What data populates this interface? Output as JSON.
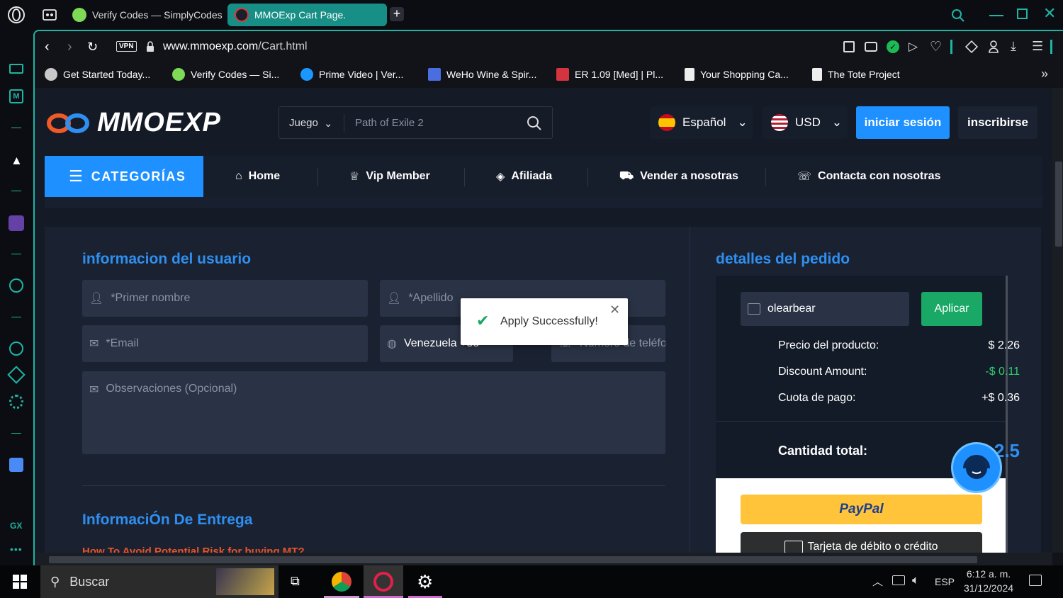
{
  "browser": {
    "tabs": [
      {
        "label": "Verify Codes — SimplyCodes"
      },
      {
        "label": "MMOExp Cart Page."
      }
    ],
    "vpn_label": "VPN",
    "url_host": "www.mmoexp.com",
    "url_path": "/Cart.html",
    "bookmarks": [
      {
        "label": "Get Started Today..."
      },
      {
        "label": "Verify Codes — Si..."
      },
      {
        "label": "Prime Video | Ver..."
      },
      {
        "label": "WeHo Wine & Spir..."
      },
      {
        "label": "ER 1.09 [Med] | Pl..."
      },
      {
        "label": "Your Shopping Ca..."
      },
      {
        "label": "The Tote Project"
      }
    ],
    "sidebar_gx": "GX",
    "accent": "#1db5a5"
  },
  "site": {
    "logo": "MMOEXP",
    "game_select": "Juego",
    "search_placeholder": "Path of Exile 2",
    "language": "Español",
    "currency": "USD",
    "login_label": "iniciar sesión",
    "signup_label": "inscribirse",
    "nav": {
      "categories": "CATEGORÍAS",
      "items": [
        {
          "label": "Home"
        },
        {
          "label": "Vip Member"
        },
        {
          "label": "Afiliada"
        },
        {
          "label": "Vender a nosotras"
        },
        {
          "label": "Contacta con nosotras"
        }
      ]
    },
    "user_info": {
      "title": "informacion del usuario",
      "first_name_placeholder": "*Primer nombre",
      "last_name_placeholder": "*Apellido",
      "email_placeholder": "*Email",
      "country": "Venezuela +58",
      "phone_placeholder": "Número de teléfono",
      "notes_placeholder": "Observaciones (Opcional)"
    },
    "delivery": {
      "title": "InformaciÓn De Entrega",
      "link": "How To Avoid Potential Risk for buying MT?"
    },
    "order": {
      "title": "detalles del pedido",
      "coupon_value": "olearbear",
      "apply_label": "Aplicar",
      "rows": [
        {
          "label": "Precio del producto:",
          "value": "$ 2.26"
        },
        {
          "label": "Discount Amount:",
          "value": "-$ 0.11"
        },
        {
          "label": "Cuota de pago:",
          "value": "+$ 0.36"
        }
      ],
      "total_label": "Cantidad total:",
      "total_value": "$ 2.5",
      "paypal_label": "PayPal",
      "card_label": "Tarjeta de débito o crédito"
    },
    "toast": "Apply Successfully!"
  },
  "taskbar": {
    "search_label": "Buscar",
    "lang": "ESP",
    "time": "6:12 a. m.",
    "date": "31/12/2024"
  },
  "colors": {
    "brand_blue": "#1e90ff",
    "apply_green": "#1aa866",
    "discount_green": "#2ecc71",
    "paypal_yellow": "#ffc439"
  }
}
